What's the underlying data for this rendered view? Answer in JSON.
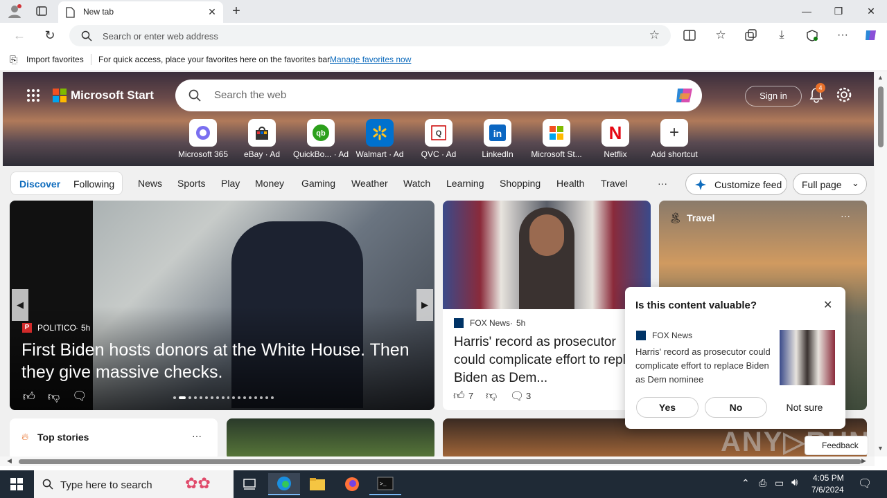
{
  "browser": {
    "tab_title": "New tab",
    "address_placeholder": "Search or enter web address",
    "favbar": {
      "import_label": "Import favorites",
      "hint_text": "For quick access, place your favorites here on the favorites bar.",
      "manage_link": "Manage favorites now"
    }
  },
  "header": {
    "brand": "Microsoft Start",
    "search_placeholder": "Search the web",
    "sign_in": "Sign in",
    "notification_count": "4"
  },
  "shortcuts": [
    {
      "label": "Microsoft 365",
      "icon": "microsoft365-icon"
    },
    {
      "label": "eBay · Ad",
      "icon": "ebay-icon"
    },
    {
      "label": "QuickBo... · Ad",
      "icon": "quickbooks-icon"
    },
    {
      "label": "Walmart · Ad",
      "icon": "walmart-icon"
    },
    {
      "label": "QVC · Ad",
      "icon": "qvc-icon"
    },
    {
      "label": "LinkedIn",
      "icon": "linkedin-icon"
    },
    {
      "label": "Microsoft St...",
      "icon": "microsoft-store-icon"
    },
    {
      "label": "Netflix",
      "icon": "netflix-icon"
    },
    {
      "label": "Add shortcut",
      "icon": "plus-icon"
    }
  ],
  "nav": {
    "discover": "Discover",
    "following": "Following",
    "items": [
      "News",
      "Sports",
      "Play",
      "Money",
      "Gaming",
      "Weather",
      "Watch",
      "Learning",
      "Shopping",
      "Health",
      "Travel"
    ],
    "more": "···",
    "customize": "Customize feed",
    "layout": "Full page"
  },
  "lead_story": {
    "source": "POLITICO",
    "age": "5h",
    "headline": "First Biden hosts donors at the White House. Then they give massive checks."
  },
  "harris_story": {
    "source": "FOX News",
    "age": "5h",
    "headline": "Harris' record as prosecutor could complicate effort to replace Biden as Dem...",
    "likes": "7",
    "comments": "3"
  },
  "travel_card": {
    "title": "Travel"
  },
  "feedback_popup": {
    "question": "Is this content valuable?",
    "source": "FOX News",
    "text": "Harris' record as prosecutor could complicate effort to replace Biden as Dem nominee",
    "yes": "Yes",
    "no": "No",
    "not_sure": "Not sure"
  },
  "top_stories": {
    "title": "Top stories",
    "more": "···"
  },
  "feedback_button": "Feedback",
  "taskbar": {
    "search_placeholder": "Type here to search",
    "time": "4:05 PM",
    "date": "7/6/2024"
  },
  "colors": {
    "accent": "#0f6cbd",
    "titlebar": "#e8eaed",
    "taskbar": "#1f2a36",
    "netflix": "#e50914",
    "badge": "#e8702a"
  }
}
